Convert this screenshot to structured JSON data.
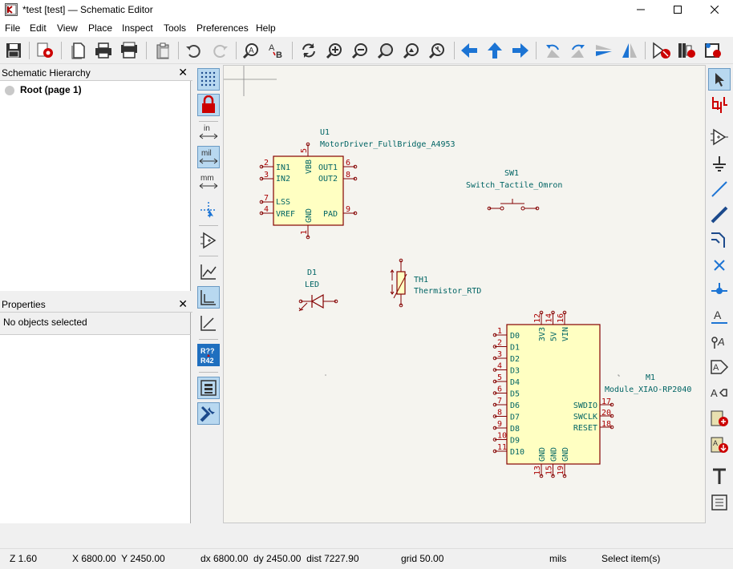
{
  "window": {
    "title": "*test [test] — Schematic Editor"
  },
  "menu": [
    "File",
    "Edit",
    "View",
    "Place",
    "Inspect",
    "Tools",
    "Preferences",
    "Help"
  ],
  "hierarchy": {
    "title": "Schematic Hierarchy",
    "root": "Root (page 1)"
  },
  "properties": {
    "title": "Properties",
    "empty": "No objects selected"
  },
  "units_buttons": {
    "in": "in",
    "mil": "mil",
    "mm": "mm"
  },
  "annotate_badge": {
    "top": "R??",
    "bottom": "R42"
  },
  "schematic": {
    "u1": {
      "ref": "U1",
      "value": "MotorDriver_FullBridge_A4953",
      "pins_left": [
        {
          "name": "IN1",
          "num": "2"
        },
        {
          "name": "IN2",
          "num": "3"
        },
        {
          "name": "LSS",
          "num": "7"
        },
        {
          "name": "VREF",
          "num": "4"
        }
      ],
      "pins_right": [
        {
          "name": "OUT1",
          "num": "6"
        },
        {
          "name": "OUT2",
          "num": "8"
        },
        {
          "name": "PAD",
          "num": "9"
        }
      ],
      "pin_top": {
        "name": "VBB",
        "num": "5"
      },
      "pin_bottom": {
        "name": "GND",
        "num": "1"
      }
    },
    "sw1": {
      "ref": "SW1",
      "value": "Switch_Tactile_Omron"
    },
    "d1": {
      "ref": "D1",
      "value": "LED"
    },
    "th1": {
      "ref": "TH1",
      "value": "Thermistor_RTD"
    },
    "m1": {
      "ref": "M1",
      "value": "Module_XIAO-RP2040",
      "pins_left": [
        {
          "name": "D0",
          "num": "1"
        },
        {
          "name": "D1",
          "num": "2"
        },
        {
          "name": "D2",
          "num": "3"
        },
        {
          "name": "D3",
          "num": "4"
        },
        {
          "name": "D4",
          "num": "5"
        },
        {
          "name": "D5",
          "num": "6"
        },
        {
          "name": "D6",
          "num": "7"
        },
        {
          "name": "D7",
          "num": "8"
        },
        {
          "name": "D8",
          "num": "9"
        },
        {
          "name": "D9",
          "num": "10"
        },
        {
          "name": "D10",
          "num": "11"
        }
      ],
      "pins_top": [
        {
          "name": "3V3",
          "num": "12"
        },
        {
          "name": "5V",
          "num": "14"
        },
        {
          "name": "VIN",
          "num": "16"
        }
      ],
      "pins_right": [
        {
          "name": "SWDIO",
          "num": "17"
        },
        {
          "name": "SWCLK",
          "num": "20"
        },
        {
          "name": "RESET",
          "num": "18"
        }
      ],
      "pins_bottom": [
        {
          "name": "GND",
          "num": "13"
        },
        {
          "name": "GND",
          "num": "15"
        },
        {
          "name": "GND",
          "num": "19"
        }
      ]
    }
  },
  "status": {
    "zoom": "Z 1.60",
    "xy": "X 6800.00  Y 2450.00",
    "delta": "dx 6800.00  dy 2450.00  dist 7227.90",
    "grid": "grid 50.00",
    "units": "mils",
    "mode": "Select item(s)"
  },
  "colors": {
    "symbol_body": "#ffffc2",
    "symbol_line": "#840000",
    "text": "#006464",
    "pin_number": "#a00000",
    "canvas": "#f5f4ef"
  }
}
